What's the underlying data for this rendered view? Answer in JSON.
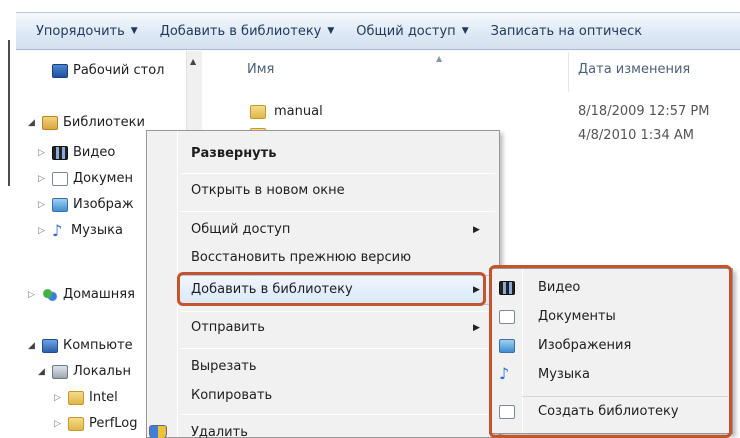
{
  "toolbar": {
    "organize": "Упорядочить",
    "add_to_library": "Добавить в библиотеку",
    "share": "Общий доступ",
    "burn": "Записать на оптическ"
  },
  "nav": {
    "desktop": "Рабочий стол",
    "libraries": "Библиотеки",
    "video": "Видео",
    "documents": "Докумен",
    "pictures": "Изображ",
    "music": "Музыка",
    "homegroup": "Домашняя",
    "computer": "Компьюте",
    "local_disk": "Локальн",
    "intel": "Intel",
    "perflogs": "PerfLog"
  },
  "content": {
    "col_name": "Имя",
    "col_date": "Дата изменения",
    "files": [
      {
        "name": "manual",
        "date": "8/18/2009 12:57 PM"
      },
      {
        "name": "",
        "date": "4/8/2010 1:34 AM"
      }
    ]
  },
  "context_menu": {
    "expand": "Развернуть",
    "open_new_window": "Открыть в новом окне",
    "share": "Общий доступ",
    "restore_previous": "Восстановить прежнюю версию",
    "add_to_library": "Добавить в библиотеку",
    "send_to": "Отправить",
    "cut": "Вырезать",
    "copy": "Копировать",
    "delete": "Удалить"
  },
  "submenu": {
    "video": "Видео",
    "documents": "Документы",
    "pictures": "Изображения",
    "music": "Музыка",
    "create_library": "Создать библиотеку"
  },
  "colors": {
    "highlight_border": "#c5542b",
    "toolbar_text": "#1e395b",
    "menu_bg": "#f1f1f1"
  }
}
